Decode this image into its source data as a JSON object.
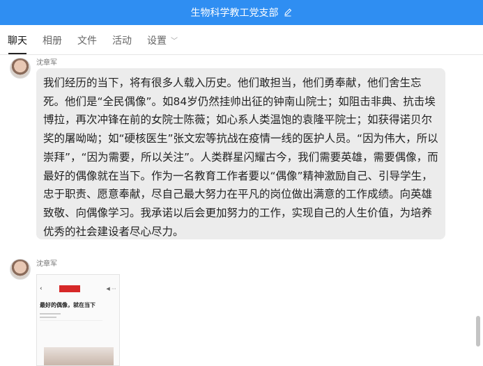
{
  "window": {
    "title": "生物科学教工党支部"
  },
  "tabs": [
    {
      "label": "聊天"
    },
    {
      "label": "相册"
    },
    {
      "label": "文件"
    },
    {
      "label": "活动"
    },
    {
      "label": "设置"
    }
  ],
  "messages": [
    {
      "sender": "沈章军",
      "text": "我们经历的当下，将有很多人载入历史。他们敢担当，他们勇奉献，他们舍生忘死。他们是“全民偶像”。如84岁仍然挂帅出征的钟南山院士；如阻击非典、抗击埃博拉，再次冲锋在前的女院士陈薇；如心系人类温饱的袁隆平院士；如获得诺贝尔奖的屠呦呦；如“硬核医生”张文宏等抗战在疫情一线的医护人员。“因为伟大，所以崇拜”，“因为需要，所以关注”。人类群星闪耀古今，我们需要英雄，需要偶像，而最好的偶像就在当下。作为一名教育工作者要以“偶像”精神激励自己、引导学生，忠于职责、愿意奉献，尽自己最大努力在平凡的岗位做出满意的工作成绩。向英雄致敬、向偶像学习。我承诺以后会更加努力的工作，实现自己的人生价值，为培养优秀的社会建设者尽心尽力。"
    },
    {
      "sender": "沈章军",
      "image_headline": "最好的偶像，就在当下"
    }
  ],
  "colors": {
    "titlebar": "#2f8ef2",
    "bubble": "#ececec"
  }
}
